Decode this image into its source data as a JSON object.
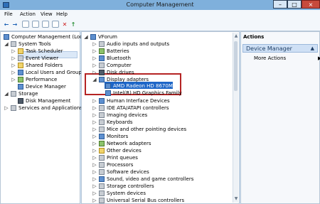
{
  "window": {
    "title": "Computer Management",
    "controls": {
      "minimize": "–",
      "maximize": "□",
      "close": "×"
    }
  },
  "menu": [
    "File",
    "Action",
    "View",
    "Help"
  ],
  "toolbar": {
    "back": "←",
    "forward": "→",
    "icons": [
      "console-tree-icon",
      "properties-icon",
      "help-icon",
      "scan-hardware-icon",
      "uninstall-icon",
      "enable-device-icon"
    ]
  },
  "left_tree": {
    "root": "Computer Management (Local",
    "system_tools": "System Tools",
    "items": [
      "Task Scheduler",
      "Event Viewer",
      "Shared Folders",
      "Local Users and Groups",
      "Performance",
      "Device Manager"
    ],
    "storage": "Storage",
    "disk_management": "Disk Management",
    "services": "Services and Applications"
  },
  "device_tree": {
    "root": "VForum",
    "items": [
      "Audio inputs and outputs",
      "Batteries",
      "Bluetooth",
      "Computer",
      "Disk drives",
      "Display adapters",
      "AMD Radeon HD 8670M",
      "Intel(R) HD Graphics Family",
      "Human Interface Devices",
      "IDE ATA/ATAPI controllers",
      "Imaging devices",
      "Keyboards",
      "Mice and other pointing devices",
      "Monitors",
      "Network adapters",
      "Other devices",
      "Print queues",
      "Processors",
      "Software devices",
      "Sound, video and game controllers",
      "Storage controllers",
      "System devices",
      "Universal Serial Bus controllers"
    ]
  },
  "actions": {
    "title": "Actions",
    "section": "Device Manager",
    "more": "More Actions"
  }
}
